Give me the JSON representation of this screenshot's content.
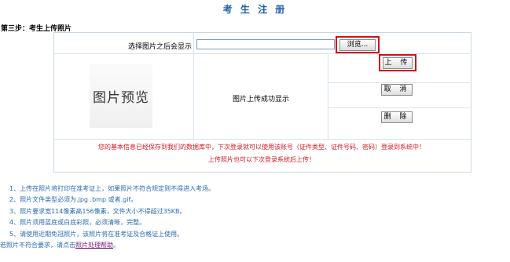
{
  "page_title": "考 生 注 册",
  "step_label": "第三步：考生上传照片",
  "upload_form": {
    "choose_label": "选择图片之后会显示",
    "file_value": "",
    "browse_button": "浏览...",
    "upload_button": "上 传",
    "cancel_button": "取 消",
    "delete_button": "删 除",
    "preview_text": "图片预览",
    "status_text": "图片上传成功显示"
  },
  "messages": {
    "saved": "您的基本信息已经保存到我们的数据库中，下次登录就可以使用该账号（证件类型、证件号码、密码）登录到系统中！",
    "later": "上传照片也可以下次登录系统后上传！"
  },
  "notes": [
    "1、上传在照片将打印在准考证上，如果照片不符合规定则不得进入考场。",
    "2、照片文件类型必须为.jpg .bmp 或者.gif。",
    "3、照片要求宽114像素高156像素，文件大小不得超过35KB。",
    "4、照片须用蓝底或白底彩照，必须清晰，完整。",
    "5、请使用近期免冠照片，该照片将在准考证及合格证上使用。"
  ],
  "help": {
    "prefix": "若照片不符合要求，请点击",
    "link_text": "照片处理帮助",
    "suffix": "。"
  },
  "colors": {
    "title": "#1f5fa7",
    "highlight_border": "#d0101a",
    "message": "#d3171f",
    "notes": "#2a6bb0",
    "link": "#7a1a7a"
  }
}
